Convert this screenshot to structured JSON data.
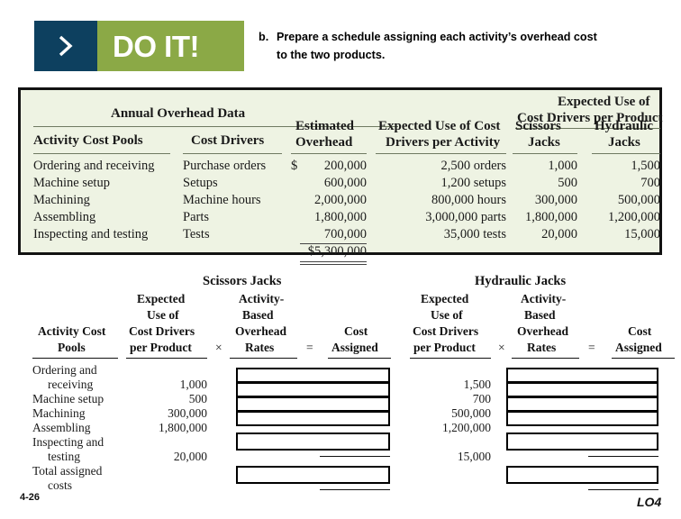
{
  "banner": {
    "chevron_icon": "chevron-right-icon",
    "label": "DO IT!",
    "navy_color": "#0d405f",
    "green_color": "#8ba946"
  },
  "instruction": {
    "marker": "b.",
    "line1": "Prepare a schedule assigning each activity’s overhead cost",
    "line2": "to the two products."
  },
  "overhead_table": {
    "background_color": "#eef3e3",
    "group_title": "Annual Overhead Data",
    "group_title_right_line1": "Expected Use of",
    "group_title_right_line2": "Cost Drivers per Product",
    "headers": {
      "activity_cost_pools": "Activity Cost Pools",
      "cost_drivers": "Cost Drivers",
      "estimated_overhead_line1": "Estimated",
      "estimated_overhead_line2": "Overhead",
      "expected_use_activity_line1": "Expected Use of Cost",
      "expected_use_activity_line2": "Drivers per Activity",
      "scissors_line1": "Scissors",
      "scissors_line2": "Jacks",
      "hydraulic_line1": "Hydraulic",
      "hydraulic_line2": "Jacks"
    },
    "rows": [
      {
        "pool": "Ordering and receiving",
        "driver": "Purchase orders",
        "overhead_symbol": "$",
        "overhead": "200,000",
        "expected_use_activity": "2,500 orders",
        "scissors": "1,000",
        "hydraulic": "1,500"
      },
      {
        "pool": "Machine setup",
        "driver": "Setups",
        "overhead_symbol": "",
        "overhead": "600,000",
        "expected_use_activity": "1,200 setups",
        "scissors": "500",
        "hydraulic": "700"
      },
      {
        "pool": "Machining",
        "driver": "Machine hours",
        "overhead_symbol": "",
        "overhead": "2,000,000",
        "expected_use_activity": "800,000 hours",
        "scissors": "300,000",
        "hydraulic": "500,000"
      },
      {
        "pool": "Assembling",
        "driver": "Parts",
        "overhead_symbol": "",
        "overhead": "1,800,000",
        "expected_use_activity": "3,000,000 parts",
        "scissors": "1,800,000",
        "hydraulic": "1,200,000"
      },
      {
        "pool": "Inspecting and testing",
        "driver": "Tests",
        "overhead_symbol": "",
        "overhead": "700,000",
        "expected_use_activity": "35,000 tests",
        "scissors": "20,000",
        "hydraulic": "15,000"
      }
    ],
    "total_overhead": "$5,300,000"
  },
  "worksheet": {
    "product_headers": {
      "scissors": "Scissors Jacks",
      "hydraulic": "Hydraulic Jacks"
    },
    "columns": {
      "pools_l1": "Activity Cost",
      "pools_l2": "Pools",
      "expected_l1": "Expected",
      "expected_l2": "Use of",
      "expected_l3": "Cost Drivers",
      "expected_l4": "per Product",
      "times": "×",
      "rates_l1": "Activity-",
      "rates_l2": "Based",
      "rates_l3": "Overhead",
      "rates_l4": "Rates",
      "equals": "=",
      "assigned_l1": "Cost",
      "assigned_l2": "Assigned"
    },
    "rows": [
      {
        "pool_l1": "Ordering and",
        "pool_l2": "receiving",
        "scissors": "1,000",
        "hydraulic": "1,500"
      },
      {
        "pool_l1": "Machine setup",
        "pool_l2": "",
        "scissors": "500",
        "hydraulic": "700"
      },
      {
        "pool_l1": "Machining",
        "pool_l2": "",
        "scissors": "300,000",
        "hydraulic": "500,000"
      },
      {
        "pool_l1": "Assembling",
        "pool_l2": "",
        "scissors": "1,800,000",
        "hydraulic": "1,200,000"
      },
      {
        "pool_l1": "Inspecting and",
        "pool_l2": "testing",
        "scissors": "20,000",
        "hydraulic": "15,000"
      },
      {
        "pool_l1": "Total assigned",
        "pool_l2": "costs",
        "scissors": "",
        "hydraulic": ""
      }
    ]
  },
  "footer": {
    "slide_number": "4-26",
    "learning_objective": "LO4"
  }
}
